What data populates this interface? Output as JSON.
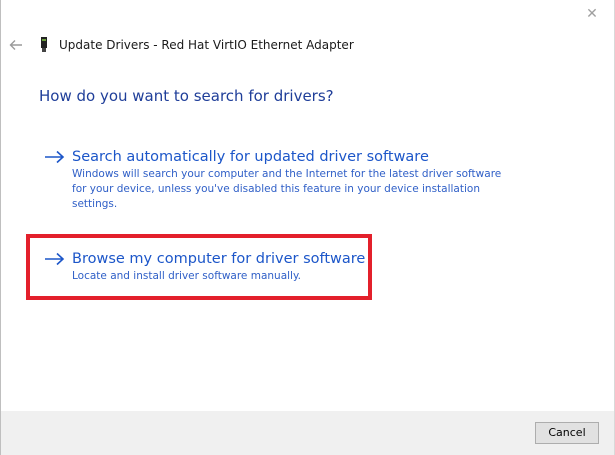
{
  "window": {
    "close_icon": "close-icon",
    "back_icon": "back-arrow-icon",
    "device_icon": "network-adapter-icon",
    "title": "Update Drivers - Red Hat VirtIO Ethernet Adapter"
  },
  "main": {
    "heading": "How do you want to search for drivers?",
    "options": [
      {
        "icon": "arrow-right-icon",
        "title": "Search automatically for updated driver software",
        "description": "Windows will search your computer and the Internet for the latest driver software for your device, unless you've disabled this feature in your device installation settings."
      },
      {
        "icon": "arrow-right-icon",
        "title": "Browse my computer for driver software",
        "description": "Locate and install driver software manually."
      }
    ]
  },
  "footer": {
    "cancel_label": "Cancel"
  },
  "colors": {
    "heading": "#1f3e99",
    "link": "#1c56c9",
    "highlight": "#e3202b",
    "footer_bg": "#f0f0f0"
  }
}
